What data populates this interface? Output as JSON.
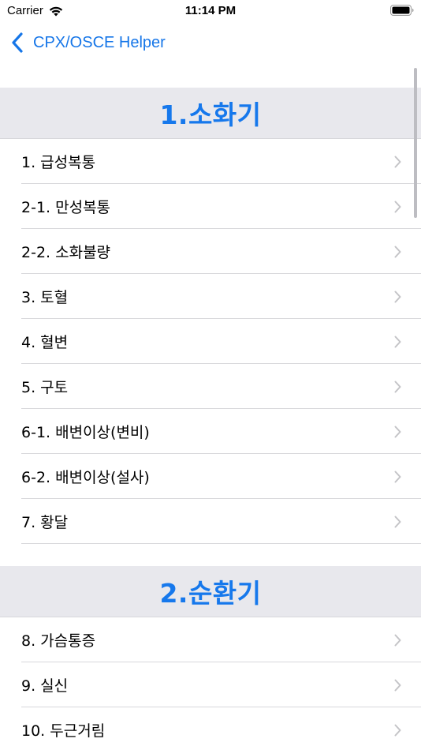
{
  "status_bar": {
    "carrier": "Carrier",
    "time": "11:14 PM"
  },
  "nav": {
    "back_label": "CPX/OSCE Helper"
  },
  "colors": {
    "accent": "#1676e8",
    "section_bg": "#e8e8ed",
    "separator": "#d7d7db"
  },
  "sections": [
    {
      "title": "1.소화기",
      "items": [
        "1. 급성복통",
        "2-1. 만성복통",
        "2-2. 소화불량",
        "3. 토혈",
        "4. 혈변",
        "5. 구토",
        "6-1. 배변이상(변비)",
        "6-2. 배변이상(설사)",
        "7. 황달"
      ]
    },
    {
      "title": "2.순환기",
      "items": [
        "8. 가슴통증",
        "9. 실신",
        "10. 두근거림"
      ]
    }
  ]
}
